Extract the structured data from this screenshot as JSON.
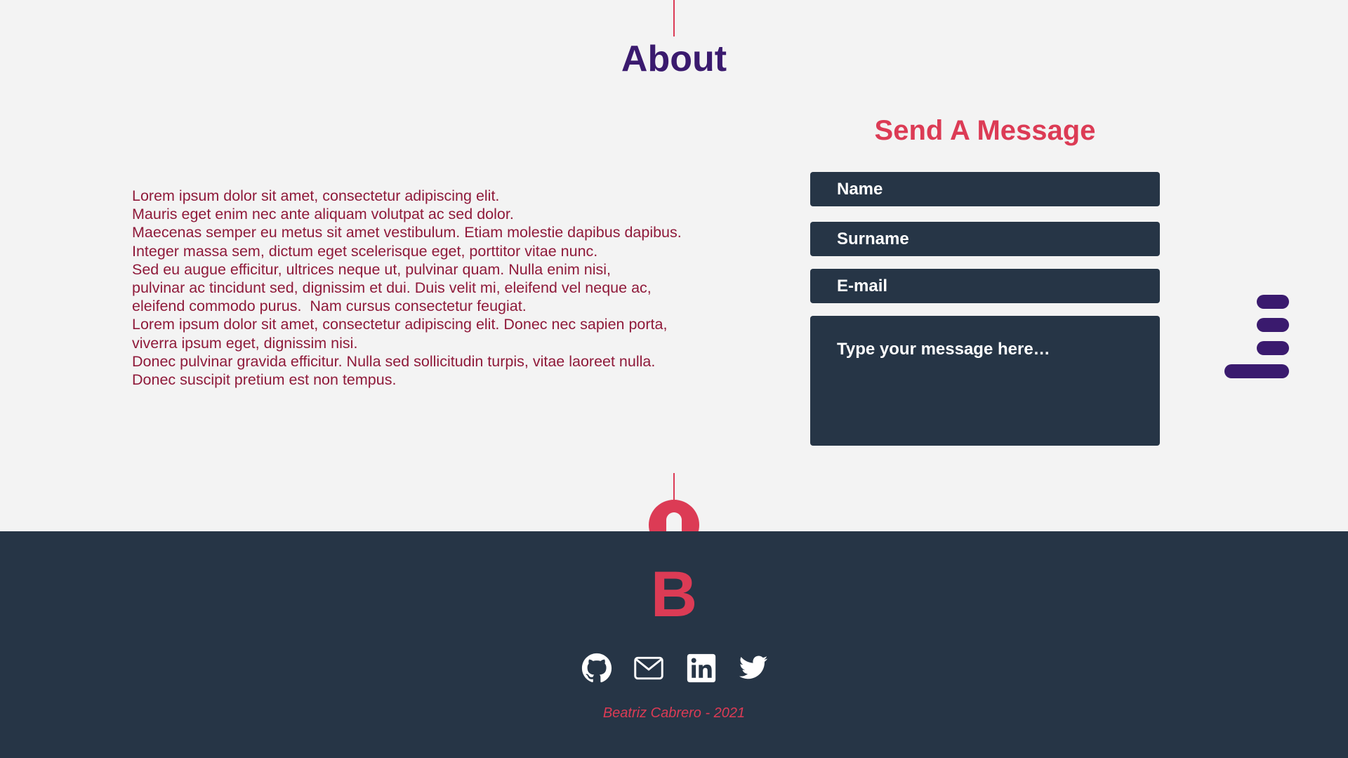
{
  "about": {
    "title": "About",
    "paragraphs": [
      "Lorem ipsum dolor sit amet, consectetur adipiscing elit.",
      "Mauris eget enim nec ante aliquam volutpat ac sed dolor.",
      "Maecenas semper eu metus sit amet vestibulum. Etiam molestie dapibus dapibus.",
      "Integer massa sem, dictum eget scelerisque eget, porttitor vitae nunc.",
      "Sed eu augue efficitur, ultrices neque ut, pulvinar quam. Nulla enim nisi,",
      "pulvinar ac tincidunt sed, dignissim et dui. Duis velit mi, eleifend vel neque ac,",
      "eleifend commodo purus.  Nam cursus consectetur feugiat.",
      "Lorem ipsum dolor sit amet, consectetur adipiscing elit. Donec nec sapien porta,",
      "viverra ipsum eget, dignissim nisi.",
      "Donec pulvinar gravida efficitur. Nulla sed sollicitudin turpis, vitae laoreet nulla.",
      "Donec suscipit pretium est non tempus."
    ]
  },
  "contact": {
    "title": "Send A Message",
    "name_placeholder": "Name",
    "surname_placeholder": "Surname",
    "email_placeholder": "E-mail",
    "message_placeholder": "Type your message here…"
  },
  "icons": {
    "menu": "hamburger-menu-icon",
    "toggle": "theme-toggle-icon",
    "github": "github-icon",
    "mail": "mail-icon",
    "linkedin": "linkedin-icon",
    "twitter": "twitter-icon"
  },
  "footer": {
    "logo": "B",
    "credit": "Beatriz Cabrero - 2021"
  },
  "colors": {
    "background": "#f3f3f3",
    "accent": "#dc3b55",
    "purple": "#3a1a6e",
    "navy": "#263546",
    "text": "#8f1a3a"
  }
}
